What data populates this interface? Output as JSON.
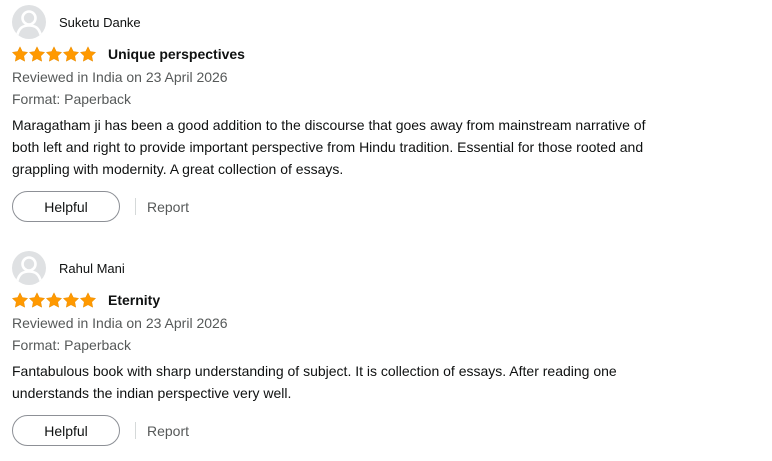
{
  "colors": {
    "star": "#ff9900",
    "text": "#0f1111",
    "secondary": "#565959",
    "avatar_bg": "#dfe1e3"
  },
  "reviews": [
    {
      "profile_name": "Suketu Danke",
      "rating": 5,
      "rating_max": 5,
      "title": "Unique perspectives",
      "date_line": "Reviewed in India on 23 April 2026",
      "format_line": "Format: Paperback",
      "body_lines": [
        "Maragatham ji has been a good addition to the discourse that goes away from mainstream narrative of",
        "both left and right to provide important perspective from Hindu tradition. Essential for those rooted and",
        "grappling with modernity. A great collection of essays."
      ],
      "helpful_label": "Helpful",
      "report_label": "Report"
    },
    {
      "profile_name": "Rahul Mani",
      "rating": 5,
      "rating_max": 5,
      "title": "Eternity",
      "date_line": "Reviewed in India on 23 April 2026",
      "format_line": "Format: Paperback",
      "body_lines": [
        "Fantabulous book with sharp understanding of subject. It is collection of essays. After reading one",
        "understands the indian perspective very well."
      ],
      "helpful_label": "Helpful",
      "report_label": "Report"
    }
  ]
}
